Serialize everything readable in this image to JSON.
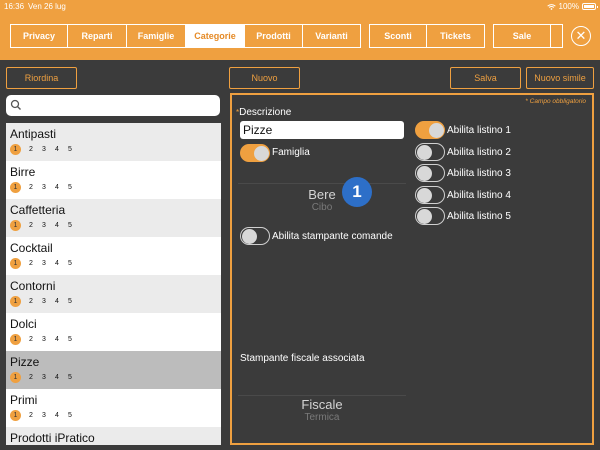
{
  "status": {
    "time": "16:36",
    "date": "Ven 26 lug",
    "battery": "100%"
  },
  "nav": {
    "tabs": [
      {
        "label": "Privacy",
        "active": false
      },
      {
        "label": "Reparti",
        "active": false
      },
      {
        "label": "Famiglie",
        "active": false
      },
      {
        "label": "Categorie",
        "active": true
      },
      {
        "label": "Prodotti",
        "active": false
      },
      {
        "label": "Varianti",
        "active": false
      },
      {
        "label": "Sconti",
        "active": false
      },
      {
        "label": "Tickets",
        "active": false
      },
      {
        "label": "Sale",
        "active": false
      }
    ],
    "close": "✕"
  },
  "buttons": {
    "reorder": "Riordina",
    "new": "Nuovo",
    "save": "Salva",
    "new_similar": "Nuovo simile"
  },
  "search": {
    "placeholder": ""
  },
  "list": {
    "items": [
      {
        "name": "Antipasti",
        "levels": [
          "1",
          "2",
          "3",
          "4",
          "5"
        ],
        "selected": false
      },
      {
        "name": "Birre",
        "levels": [
          "1",
          "2",
          "3",
          "4",
          "5"
        ],
        "selected": false
      },
      {
        "name": "Caffetteria",
        "levels": [
          "1",
          "2",
          "3",
          "4",
          "5"
        ],
        "selected": false
      },
      {
        "name": "Cocktail",
        "levels": [
          "1",
          "2",
          "3",
          "4",
          "5"
        ],
        "selected": false
      },
      {
        "name": "Contorni",
        "levels": [
          "1",
          "2",
          "3",
          "4",
          "5"
        ],
        "selected": false
      },
      {
        "name": "Dolci",
        "levels": [
          "1",
          "2",
          "3",
          "4",
          "5"
        ],
        "selected": false
      },
      {
        "name": "Pizze",
        "levels": [
          "1",
          "2",
          "3",
          "4",
          "5"
        ],
        "selected": true
      },
      {
        "name": "Primi",
        "levels": [
          "1",
          "2",
          "3",
          "4",
          "5"
        ],
        "selected": false
      },
      {
        "name": "Prodotti iPratico",
        "levels": [],
        "selected": false
      }
    ]
  },
  "form": {
    "required_note": "* Campo obbligatorio",
    "description_label": "Descrizione",
    "description_star": "*",
    "description_value": "Pizze",
    "famiglia_label": "Famiglia",
    "famiglia_on": true,
    "family_picker": {
      "selected": "Bere",
      "next": "Cibo"
    },
    "badge": "1",
    "print_orders_label": "Abilita stampante comande",
    "print_orders_on": false,
    "fiscal_label": "Stampante fiscale associata",
    "fiscal_picker": {
      "selected": "Fiscale",
      "next": "Termica"
    },
    "listini": [
      {
        "label": "Abilita listino 1",
        "on": true
      },
      {
        "label": "Abilita listino 2",
        "on": false
      },
      {
        "label": "Abilita listino 3",
        "on": false
      },
      {
        "label": "Abilita listino 4",
        "on": false
      },
      {
        "label": "Abilita listino 5",
        "on": false
      }
    ]
  },
  "colors": {
    "accent": "#efa040",
    "background": "#3b3b3b",
    "badge": "#2d6fc8"
  }
}
